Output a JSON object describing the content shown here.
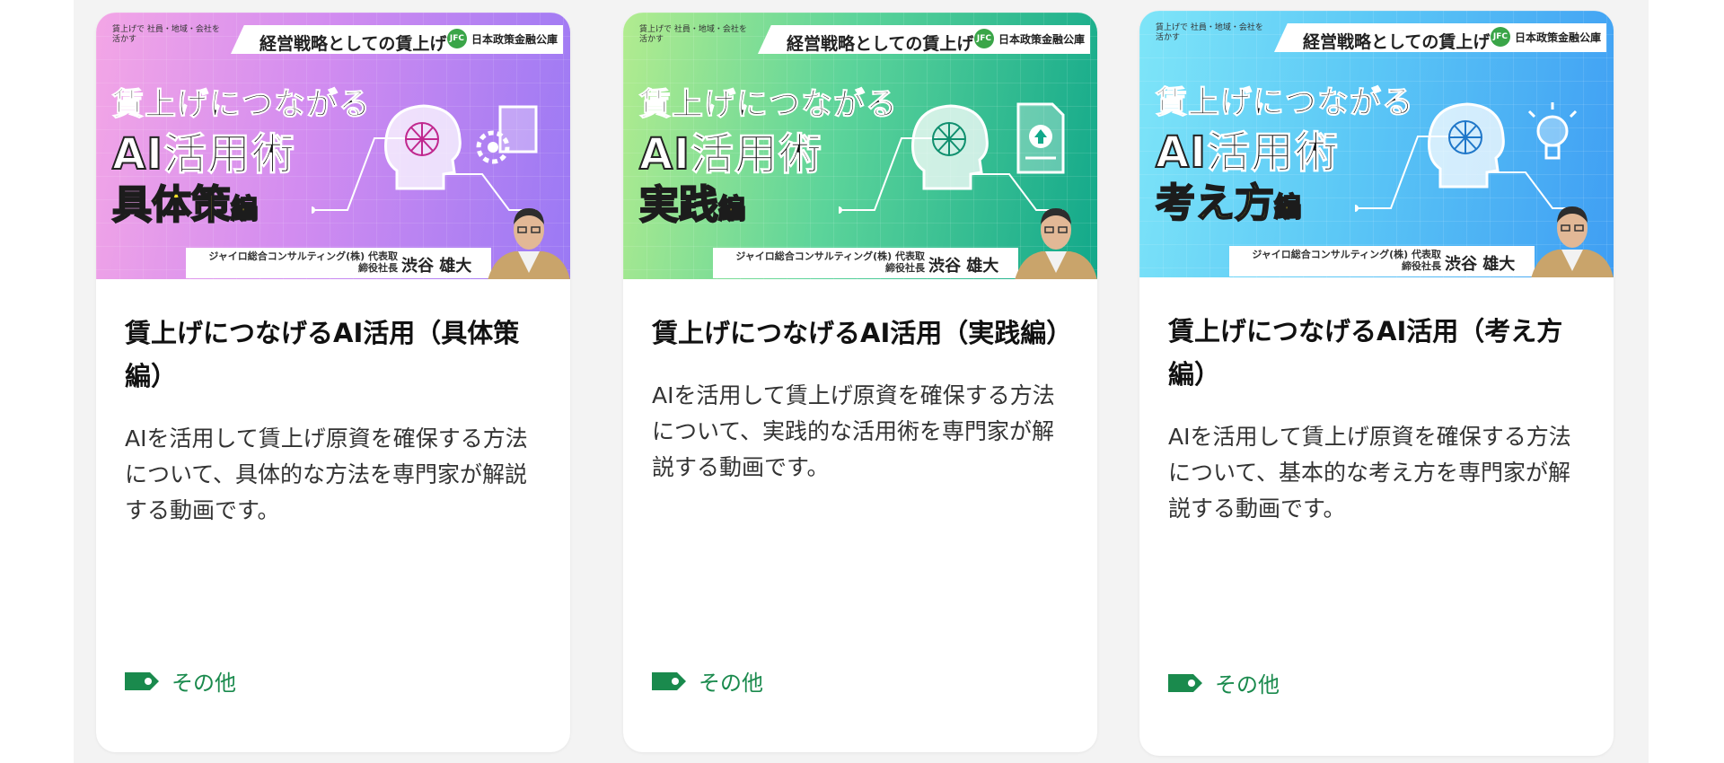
{
  "cards": [
    {
      "thumb": {
        "banner_small": "賃上げで 社員・地域・会社を活かす",
        "banner_strategy": "経営戦略としての賃上げ",
        "jfc_logo": "JFC",
        "jfc_name": "日本政策金融公庫",
        "title_line1": "賃上げにつながる",
        "title_ai": "AI",
        "title_line2_rest": "活用術",
        "title_line3": "具体策",
        "title_line3_suffix": "編",
        "company": "ジャイロ総合コンサルティング(株) 代表取締役社長",
        "person": "渋谷 雄大",
        "side_icon": "gear-document-icon",
        "color_start": "#f3a6e6",
        "color_end": "#9a79f4"
      },
      "title": "賃上げにつなげるAI活用（具体策編）",
      "description": "AIを活用して賃上げ原資を確保する方法について、具体的な方法を専門家が解説する動画です。",
      "tag": "その他"
    },
    {
      "thumb": {
        "banner_small": "賃上げで 社員・地域・会社を活かす",
        "banner_strategy": "経営戦略としての賃上げ",
        "jfc_logo": "JFC",
        "jfc_name": "日本政策金融公庫",
        "title_line1": "賃上げにつながる",
        "title_ai": "AI",
        "title_line2_rest": "活用術",
        "title_line3": "実践",
        "title_line3_suffix": "編",
        "company": "ジャイロ総合コンサルティング(株) 代表取締役社長",
        "person": "渋谷 雄大",
        "side_icon": "document-upload-icon",
        "color_start": "#b2ec8f",
        "color_end": "#12a88a"
      },
      "title": "賃上げにつなげるAI活用（実践編）",
      "description": "AIを活用して賃上げ原資を確保する方法について、実践的な活用術を専門家が解説する動画です。",
      "tag": "その他"
    },
    {
      "thumb": {
        "banner_small": "賃上げで 社員・地域・会社を活かす",
        "banner_strategy": "経営戦略としての賃上げ",
        "jfc_logo": "JFC",
        "jfc_name": "日本政策金融公庫",
        "title_line1": "賃上げにつながる",
        "title_ai": "AI",
        "title_line2_rest": "活用術",
        "title_line3": "考え方",
        "title_line3_suffix": "編",
        "company": "ジャイロ総合コンサルティング(株) 代表取締役社長",
        "person": "渋谷 雄大",
        "side_icon": "lightbulb-icon",
        "color_start": "#7ee5f8",
        "color_end": "#3f9ef3"
      },
      "title": "賃上げにつなげるAI活用（考え方編）",
      "description": "AIを活用して賃上げ原資を確保する方法について、基本的な考え方を専門家が解説する動画です。",
      "tag": "その他"
    }
  ],
  "colors": {
    "tag_green": "#1a8a4d",
    "panel_bg": "#f3f3f3",
    "highlight_yellow": "#fbe12c"
  }
}
